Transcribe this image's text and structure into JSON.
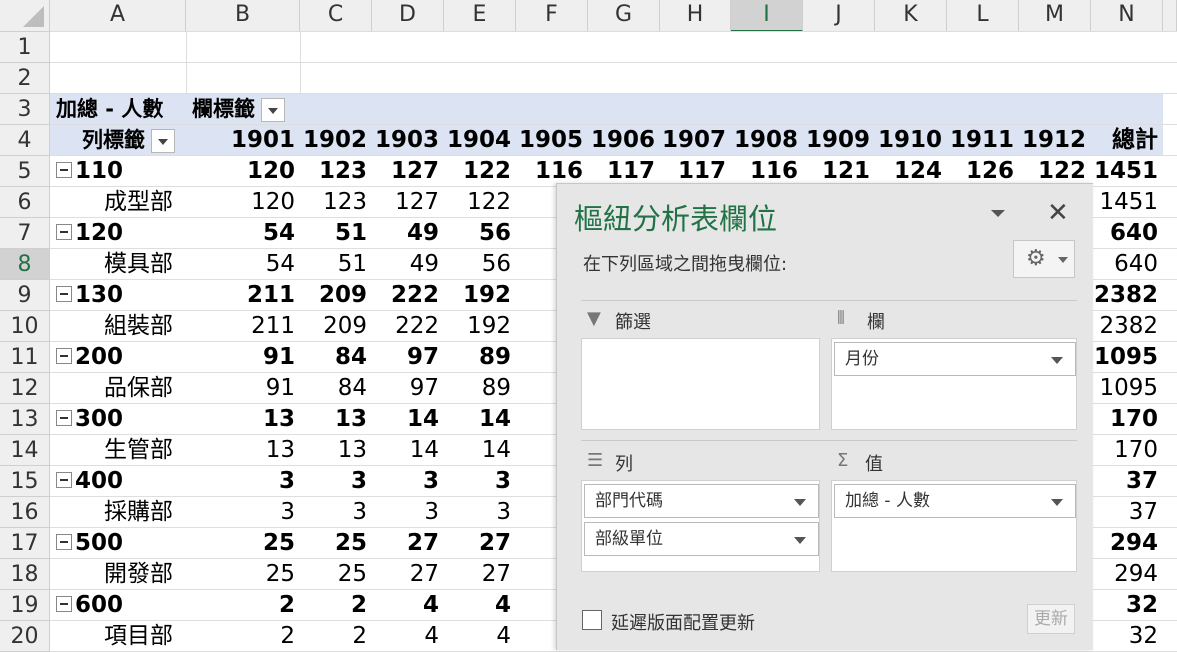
{
  "columns": [
    "A",
    "B",
    "C",
    "D",
    "E",
    "F",
    "G",
    "H",
    "I",
    "J",
    "K",
    "L",
    "M",
    "N"
  ],
  "selected_column": "I",
  "rows": [
    "1",
    "2",
    "3",
    "4",
    "5",
    "6",
    "7",
    "8",
    "9",
    "10",
    "11",
    "12",
    "13",
    "14",
    "15",
    "16",
    "17",
    "18",
    "19",
    "20"
  ],
  "selected_row": "8",
  "pivot": {
    "values_label": "加總 - 人數",
    "col_labels_label": "欄標籤",
    "row_labels_label": "列標籤",
    "months": [
      "1901",
      "1902",
      "1903",
      "1904",
      "1905",
      "1906",
      "1907",
      "1908",
      "1909",
      "1910",
      "1911",
      "1912"
    ],
    "total_label": "總計",
    "groups": [
      {
        "code": "110",
        "dept": "成型部",
        "vals": [
          "120",
          "123",
          "127",
          "122",
          "116",
          "117",
          "117",
          "116",
          "121",
          "124",
          "126",
          "122"
        ],
        "total": "1451",
        "dvals": [
          "120",
          "123",
          "127",
          "122",
          "1"
        ]
      },
      {
        "code": "120",
        "dept": "模具部",
        "vals": [
          "54",
          "51",
          "49",
          "56"
        ],
        "total": "640",
        "dvals": [
          "54",
          "51",
          "49",
          "56"
        ]
      },
      {
        "code": "130",
        "dept": "組裝部",
        "vals": [
          "211",
          "209",
          "222",
          "192",
          "1"
        ],
        "total": "2382",
        "dvals": [
          "211",
          "209",
          "222",
          "192",
          "1"
        ]
      },
      {
        "code": "200",
        "dept": "品保部",
        "vals": [
          "91",
          "84",
          "97",
          "89"
        ],
        "total": "1095",
        "dvals": [
          "91",
          "84",
          "97",
          "89"
        ]
      },
      {
        "code": "300",
        "dept": "生管部",
        "vals": [
          "13",
          "13",
          "14",
          "14"
        ],
        "total": "170",
        "dvals": [
          "13",
          "13",
          "14",
          "14"
        ]
      },
      {
        "code": "400",
        "dept": "採購部",
        "vals": [
          "3",
          "3",
          "3",
          "3"
        ],
        "total": "37",
        "dvals": [
          "3",
          "3",
          "3",
          "3"
        ]
      },
      {
        "code": "500",
        "dept": "開發部",
        "vals": [
          "25",
          "25",
          "27",
          "27"
        ],
        "total": "294",
        "dvals": [
          "25",
          "25",
          "27",
          "27"
        ]
      },
      {
        "code": "600",
        "dept": "項目部",
        "vals": [
          "2",
          "2",
          "4",
          "4"
        ],
        "total": "32",
        "dvals": [
          "2",
          "2",
          "4",
          "4"
        ]
      }
    ]
  },
  "pane": {
    "title": "樞紐分析表欄位",
    "close": "✕",
    "subtitle": "在下列區域之間拖曳欄位:",
    "filters_label": "篩選",
    "columns_label": "欄",
    "rows_label": "列",
    "values_label": "值",
    "column_field": "月份",
    "row_field_1": "部門代碼",
    "row_field_2": "部級單位",
    "value_field": "加總 - 人數",
    "defer_label": "延遲版面配置更新",
    "update_label": "更新"
  }
}
